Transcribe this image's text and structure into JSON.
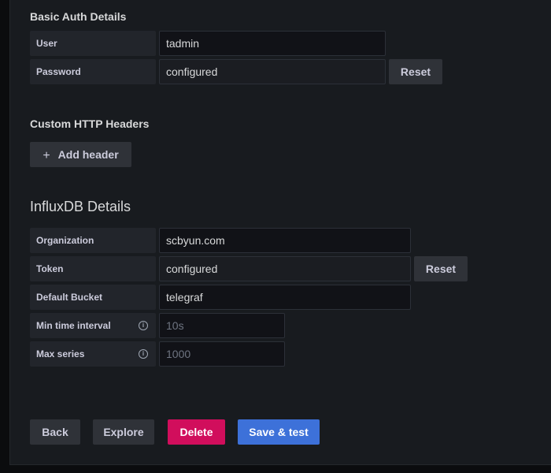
{
  "basic_auth": {
    "title": "Basic Auth Details",
    "user_label": "User",
    "user_value": "tadmin",
    "password_label": "Password",
    "password_value": "configured",
    "reset_label": "Reset"
  },
  "custom_headers": {
    "title": "Custom HTTP Headers",
    "add_header_label": "Add header"
  },
  "influxdb": {
    "title": "InfluxDB Details",
    "organization_label": "Organization",
    "organization_value": "scbyun.com",
    "token_label": "Token",
    "token_value": "configured",
    "token_reset_label": "Reset",
    "bucket_label": "Default Bucket",
    "bucket_value": "telegraf",
    "min_interval_label": "Min time interval",
    "min_interval_placeholder": "10s",
    "max_series_label": "Max series",
    "max_series_placeholder": "1000"
  },
  "footer": {
    "back_label": "Back",
    "explore_label": "Explore",
    "delete_label": "Delete",
    "save_label": "Save & test"
  },
  "colors": {
    "background": "#181b1f",
    "primary": "#3d71d9",
    "danger": "#d10e5c"
  }
}
